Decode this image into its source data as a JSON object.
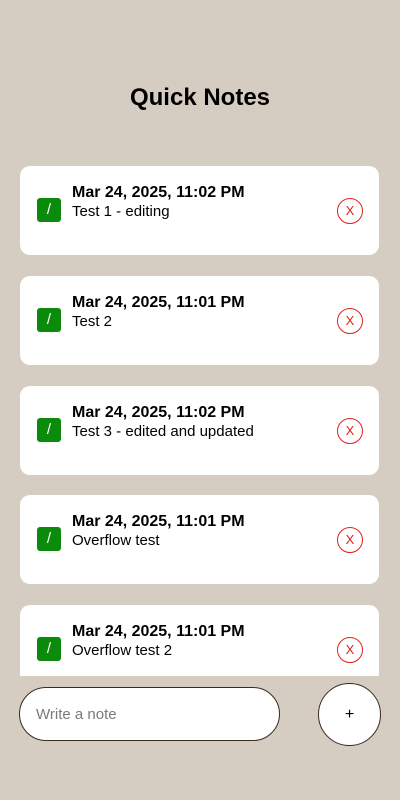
{
  "app": {
    "title": "Quick Notes"
  },
  "notes": [
    {
      "date": "Mar 24, 2025, 11:02 PM",
      "text": "Test 1 - editing"
    },
    {
      "date": "Mar 24, 2025, 11:01 PM",
      "text": "Test 2"
    },
    {
      "date": "Mar 24, 2025, 11:02 PM",
      "text": "Test 3 - edited and updated"
    },
    {
      "date": "Mar 24, 2025, 11:01 PM",
      "text": "Overflow test"
    },
    {
      "date": "Mar 24, 2025, 11:01 PM",
      "text": "Overflow test 2"
    }
  ],
  "actions": {
    "edit_label": "/",
    "delete_label": "X",
    "add_label": "+"
  },
  "composer": {
    "placeholder": "Write a note",
    "value": ""
  },
  "icons": {
    "edit": "pencil-icon",
    "delete": "close-icon",
    "add": "plus-icon"
  },
  "colors": {
    "background": "#d6cdc2",
    "edit": "#0b8a0b",
    "delete": "#e0231c"
  }
}
